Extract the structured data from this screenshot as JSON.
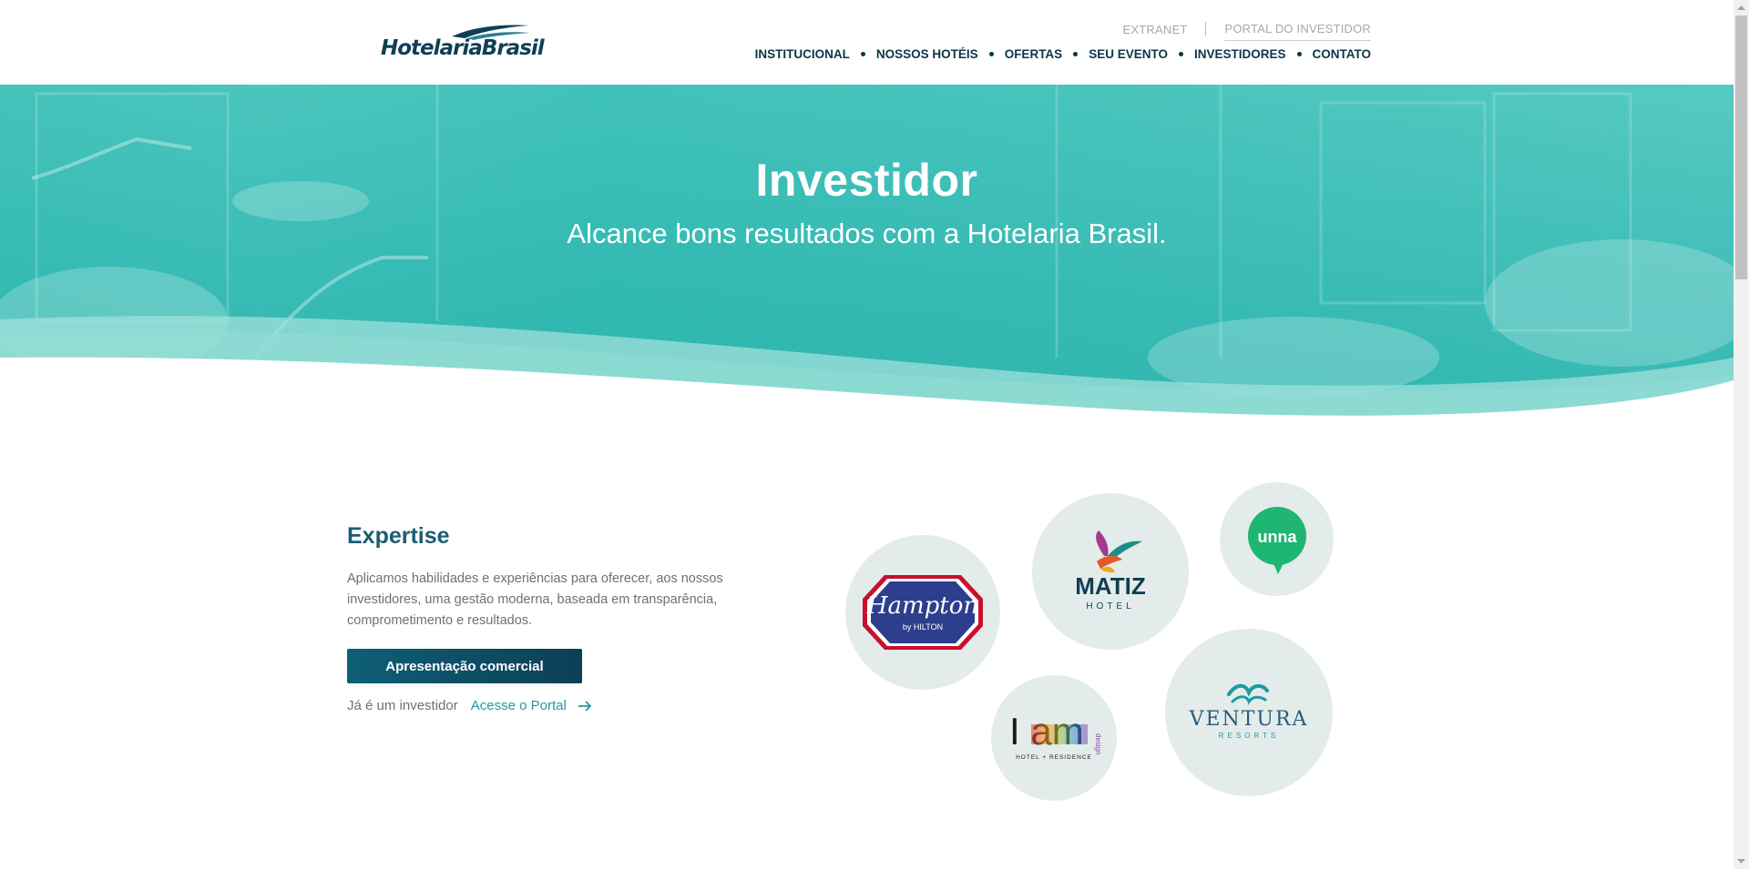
{
  "brand": {
    "name": "HotelariaBrasil"
  },
  "header": {
    "top_links": {
      "extranet": "EXTRANET",
      "portal": "PORTAL DO INVESTIDOR"
    },
    "nav": [
      "INSTITUCIONAL",
      "NOSSOS HOTÉIS",
      "OFERTAS",
      "SEU EVENTO",
      "INVESTIDORES",
      "CONTATO"
    ]
  },
  "hero": {
    "title": "Investidor",
    "subtitle": "Alcance bons resultados com a Hotelaria Brasil."
  },
  "expertise": {
    "title": "Expertise",
    "text": "Aplicamos habilidades e experiências para oferecer, aos nossos investidores, uma gestão moderna, baseada em transparência, comprometimento e resultados.",
    "button_label": "Apresentação comercial",
    "investor_prompt": "Já é um investidor",
    "portal_link": "Acesse o Portal"
  },
  "brands": {
    "hampton": {
      "name": "Hampton",
      "sub": "by HILTON"
    },
    "matiz": {
      "name": "MATIZ",
      "sub": "HOTEL"
    },
    "unna": {
      "name": "unna"
    },
    "iam": {
      "name": "I am",
      "tag": "design",
      "sub": "HOTEL + RESIDENCE"
    },
    "ventura": {
      "name": "VENTURA",
      "sub": "RESORTS"
    }
  },
  "colors": {
    "brand_dark": "#0d3547",
    "teal": "#2ab5ac",
    "accent": "#1e9aa1"
  }
}
